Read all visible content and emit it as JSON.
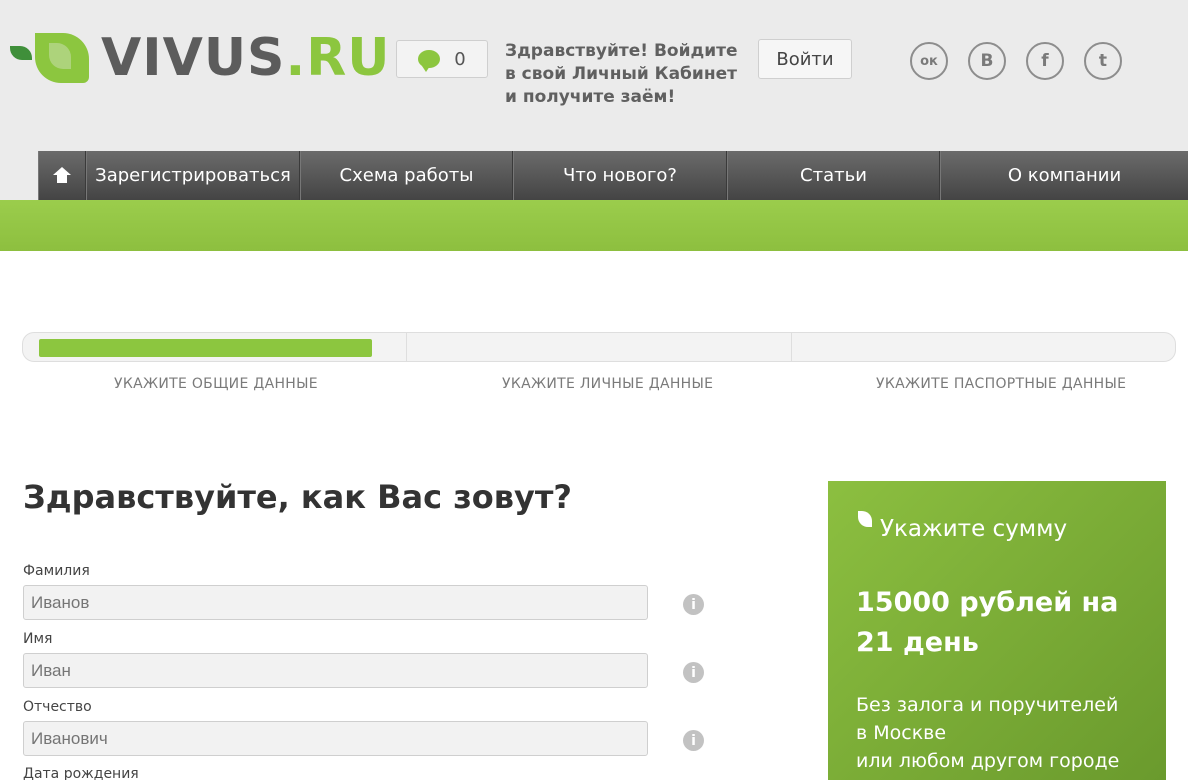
{
  "header": {
    "logo": {
      "brand": "VIVUS",
      "tld": ".RU"
    },
    "messages_count": "0",
    "greeting": "Здравствуйте! Войдите в свой Личный Кабинет и получите заём!",
    "login_label": "Войти",
    "social": [
      {
        "icon": "odnoklassniki-icon",
        "glyph": "ок"
      },
      {
        "icon": "vkontakte-icon",
        "glyph": "В"
      },
      {
        "icon": "facebook-icon",
        "glyph": "f"
      },
      {
        "icon": "twitter-icon",
        "glyph": "t"
      }
    ]
  },
  "nav": {
    "items": [
      "Зарегистрироваться",
      "Схема работы",
      "Что нового?",
      "Статьи",
      "О компании"
    ]
  },
  "progress": {
    "steps": [
      "УКАЖИТЕ ОБЩИЕ ДАННЫЕ",
      "УКАЖИТЕ ЛИЧНЫЕ ДАННЫЕ",
      "УКАЖИТЕ ПАСПОРТНЫЕ ДАННЫЕ"
    ],
    "current_step_fill": 0.95
  },
  "form": {
    "title": "Здравствуйте, как Вас зовут?",
    "fields": [
      {
        "label": "Фамилия",
        "placeholder": "Иванов"
      },
      {
        "label": "Имя",
        "placeholder": "Иван"
      },
      {
        "label": "Отчество",
        "placeholder": "Иванович"
      },
      {
        "label": "Дата рождения"
      }
    ]
  },
  "sidebar": {
    "title": "Укажите сумму",
    "amount": "15000 рублей на 21 день",
    "note_line1": "Без залога и поручителей",
    "note_line2": "в Москве",
    "note_line3": "или любом другом городе"
  },
  "colors": {
    "accent": "#8cc63f",
    "nav": "#555555",
    "text": "#333333"
  }
}
